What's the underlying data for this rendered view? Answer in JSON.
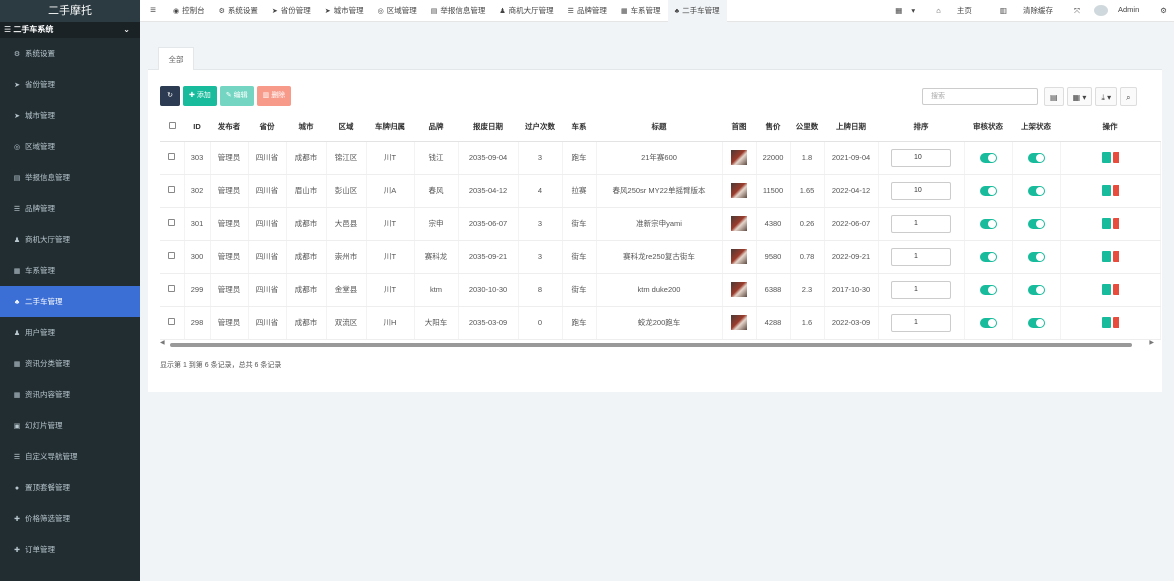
{
  "sidebar": {
    "brand": "二手摩托",
    "header": "二手车系统",
    "items": [
      {
        "icon": "gears-icon",
        "glyph": "⚙",
        "label": "系统设置"
      },
      {
        "icon": "location-arrow-icon",
        "glyph": "➤",
        "label": "省份管理"
      },
      {
        "icon": "location-arrow-icon",
        "glyph": "➤",
        "label": "城市管理"
      },
      {
        "icon": "compass-icon",
        "glyph": "◎",
        "label": "区域管理"
      },
      {
        "icon": "report-icon",
        "glyph": "▤",
        "label": "举报信息管理"
      },
      {
        "icon": "list-icon",
        "glyph": "☰",
        "label": "品牌管理"
      },
      {
        "icon": "user-icon",
        "glyph": "♟",
        "label": "商机大厅管理"
      },
      {
        "icon": "table-icon",
        "glyph": "▦",
        "label": "车系管理"
      },
      {
        "icon": "sitemap-icon",
        "glyph": "♣",
        "label": "二手车管理",
        "active": true
      },
      {
        "icon": "user-icon",
        "glyph": "♟",
        "label": "用户管理"
      },
      {
        "icon": "table-icon",
        "glyph": "▦",
        "label": "资讯分类管理"
      },
      {
        "icon": "table-icon",
        "glyph": "▦",
        "label": "资讯内容管理"
      },
      {
        "icon": "image-icon",
        "glyph": "▣",
        "label": "幻灯片管理"
      },
      {
        "icon": "list-icon",
        "glyph": "☰",
        "label": "自定义导航管理"
      },
      {
        "icon": "circle-icon",
        "glyph": "●",
        "label": "置顶套餐管理"
      },
      {
        "icon": "plus-icon",
        "glyph": "✚",
        "label": "价格筛选管理"
      },
      {
        "icon": "plus-icon",
        "glyph": "✚",
        "label": "订单管理"
      }
    ]
  },
  "topnav": {
    "tabs": [
      {
        "icon": "dashboard-icon",
        "glyph": "◉",
        "label": "控制台"
      },
      {
        "icon": "gears-icon",
        "glyph": "⚙",
        "label": "系统设置"
      },
      {
        "icon": "location-arrow-icon",
        "glyph": "➤",
        "label": "省份管理"
      },
      {
        "icon": "location-arrow-icon",
        "glyph": "➤",
        "label": "城市管理"
      },
      {
        "icon": "compass-icon",
        "glyph": "◎",
        "label": "区域管理"
      },
      {
        "icon": "report-icon",
        "glyph": "▤",
        "label": "举报信息管理"
      },
      {
        "icon": "user-icon",
        "glyph": "♟",
        "label": "商机大厅管理"
      },
      {
        "icon": "list-icon",
        "glyph": "☰",
        "label": "品牌管理"
      },
      {
        "icon": "table-icon",
        "glyph": "▦",
        "label": "车系管理"
      },
      {
        "icon": "sitemap-icon",
        "glyph": "♣",
        "label": "二手车管理",
        "active": true
      }
    ],
    "home_label": "主页",
    "clear_cache_label": "清除缓存",
    "user_name": "Admin"
  },
  "panel": {
    "tab_all": "全部",
    "toolbar": {
      "add": "添加",
      "edit": "编辑",
      "delete": "删除"
    },
    "search_placeholder": "搜索",
    "columns": [
      "",
      "ID",
      "发布者",
      "省份",
      "城市",
      "区域",
      "车牌归属",
      "品牌",
      "报废日期",
      "过户次数",
      "车系",
      "标题",
      "首图",
      "售价",
      "公里数",
      "上牌日期",
      "排序",
      "审核状态",
      "上架状态",
      "操作"
    ],
    "rows": [
      {
        "id": "303",
        "publisher": "管理员",
        "province": "四川省",
        "city": "成都市",
        "district": "锦江区",
        "plate": "川T",
        "brand": "钱江",
        "scrap_date": "2035-09-04",
        "transfers": "3",
        "series": "跑车",
        "title": "21年赛600",
        "price": "22000",
        "km": "1.8",
        "reg_date": "2021-09-04",
        "sort": "10"
      },
      {
        "id": "302",
        "publisher": "管理员",
        "province": "四川省",
        "city": "眉山市",
        "district": "彭山区",
        "plate": "川A",
        "brand": "春风",
        "scrap_date": "2035-04-12",
        "transfers": "4",
        "series": "拉赛",
        "title": "春风250sr MY22单摇臂版本",
        "price": "11500",
        "km": "1.65",
        "reg_date": "2022-04-12",
        "sort": "10"
      },
      {
        "id": "301",
        "publisher": "管理员",
        "province": "四川省",
        "city": "成都市",
        "district": "大邑县",
        "plate": "川T",
        "brand": "宗申",
        "scrap_date": "2035-06-07",
        "transfers": "3",
        "series": "街车",
        "title": "准新宗申yami",
        "price": "4380",
        "km": "0.26",
        "reg_date": "2022-06-07",
        "sort": "1"
      },
      {
        "id": "300",
        "publisher": "管理员",
        "province": "四川省",
        "city": "成都市",
        "district": "崇州市",
        "plate": "川T",
        "brand": "赛科龙",
        "scrap_date": "2035-09-21",
        "transfers": "3",
        "series": "街车",
        "title": "赛科龙re250复古街车",
        "price": "9580",
        "km": "0.78",
        "reg_date": "2022-09-21",
        "sort": "1"
      },
      {
        "id": "299",
        "publisher": "管理员",
        "province": "四川省",
        "city": "成都市",
        "district": "金堂县",
        "plate": "川T",
        "brand": "ktm",
        "scrap_date": "2030-10-30",
        "transfers": "8",
        "series": "街车",
        "title": "ktm duke200",
        "price": "6388",
        "km": "2.3",
        "reg_date": "2017-10-30",
        "sort": "1"
      },
      {
        "id": "298",
        "publisher": "管理员",
        "province": "四川省",
        "city": "成都市",
        "district": "双流区",
        "plate": "川H",
        "brand": "大阳车",
        "scrap_date": "2035-03-09",
        "transfers": "0",
        "series": "跑车",
        "title": "蛟龙200跑车",
        "price": "4288",
        "km": "1.6",
        "reg_date": "2022-03-09",
        "sort": "1"
      }
    ],
    "pager_info": "显示第 1 到第 6 条记录，总共 6 条记录"
  }
}
